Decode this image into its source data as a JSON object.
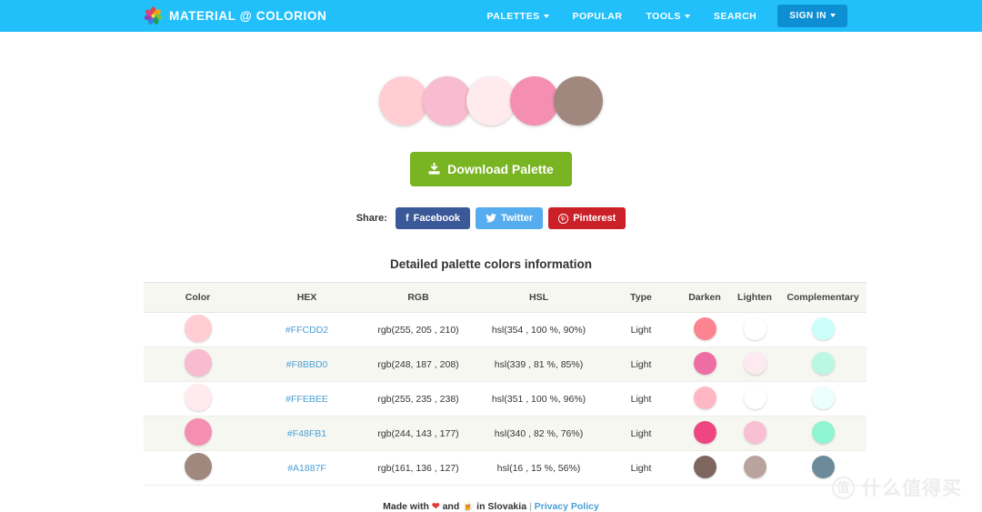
{
  "header": {
    "brand": "MATERIAL @ COLORION",
    "logo_icon": "pinwheel-flower-icon",
    "bg_color": "#22C0FA",
    "nav": [
      {
        "label": "PALETTES",
        "has_caret": true
      },
      {
        "label": "POPULAR",
        "has_caret": false
      },
      {
        "label": "TOOLS",
        "has_caret": true
      },
      {
        "label": "SEARCH",
        "has_caret": false
      }
    ],
    "signin": {
      "label": "SIGN IN",
      "has_caret": true,
      "bg_color": "#0E8FD4"
    }
  },
  "palette_preview": {
    "colors": [
      "#FFCDD2",
      "#F8BBD0",
      "#FFEBEE",
      "#F48FB1",
      "#A1887F"
    ]
  },
  "download": {
    "label": "Download Palette",
    "icon": "download-icon",
    "bg_color": "#79B422"
  },
  "share": {
    "label": "Share:",
    "buttons": [
      {
        "label": "Facebook",
        "icon": "facebook-icon",
        "glyph": "f",
        "color": "#3B5998"
      },
      {
        "label": "Twitter",
        "icon": "twitter-icon",
        "glyph": "✈",
        "color": "#55ACEE"
      },
      {
        "label": "Pinterest",
        "icon": "pinterest-icon",
        "glyph": "Ⓟ",
        "color": "#CB2027"
      }
    ]
  },
  "table": {
    "title": "Detailed palette colors information",
    "headers": [
      "Color",
      "HEX",
      "RGB",
      "HSL",
      "Type",
      "Darken",
      "Lighten",
      "Complementary"
    ],
    "rows": [
      {
        "color": "#FFCDD2",
        "hex": "#FFCDD2",
        "rgb": "rgb(255, 205 , 210)",
        "hsl": "hsl(354 , 100 %, 90%)",
        "type": "Light",
        "darken": "#FC8490",
        "lighten": "#FFFFFF",
        "complementary": "#CDFFFA"
      },
      {
        "color": "#F8BBD0",
        "hex": "#F8BBD0",
        "rgb": "rgb(248, 187 , 208)",
        "hsl": "hsl(339 , 81 %, 85%)",
        "type": "Light",
        "darken": "#EE6EA4",
        "lighten": "#FDEAF1",
        "complementary": "#BBF8E3"
      },
      {
        "color": "#FFEBEE",
        "hex": "#FFEBEE",
        "rgb": "rgb(255, 235 , 238)",
        "hsl": "hsl(351 , 100 %, 96%)",
        "type": "Light",
        "darken": "#FFB8C3",
        "lighten": "#FFFFFF",
        "complementary": "#EBFFFC"
      },
      {
        "color": "#F48FB1",
        "hex": "#F48FB1",
        "rgb": "rgb(244, 143 , 177)",
        "hsl": "hsl(340 , 82 %, 76%)",
        "type": "Light",
        "darken": "#EE4683",
        "lighten": "#F9BFD4",
        "complementary": "#8FF4D2"
      },
      {
        "color": "#A1887F",
        "hex": "#A1887F",
        "rgb": "rgb(161, 136 , 127)",
        "hsl": "hsl(16 , 15 %, 56%)",
        "type": "Light",
        "darken": "#7C665D",
        "lighten": "#B8A49D",
        "complementary": "#6B8B9B"
      }
    ]
  },
  "footer": {
    "made_with": "Made with",
    "and": "and",
    "in_place": "in Slovakia",
    "heart_icon": "heart-icon",
    "beer_icon": "beer-mug-icon",
    "separator": "|",
    "privacy": "Privacy Policy"
  },
  "watermark": {
    "badge": "值",
    "text": "什么值得买"
  }
}
